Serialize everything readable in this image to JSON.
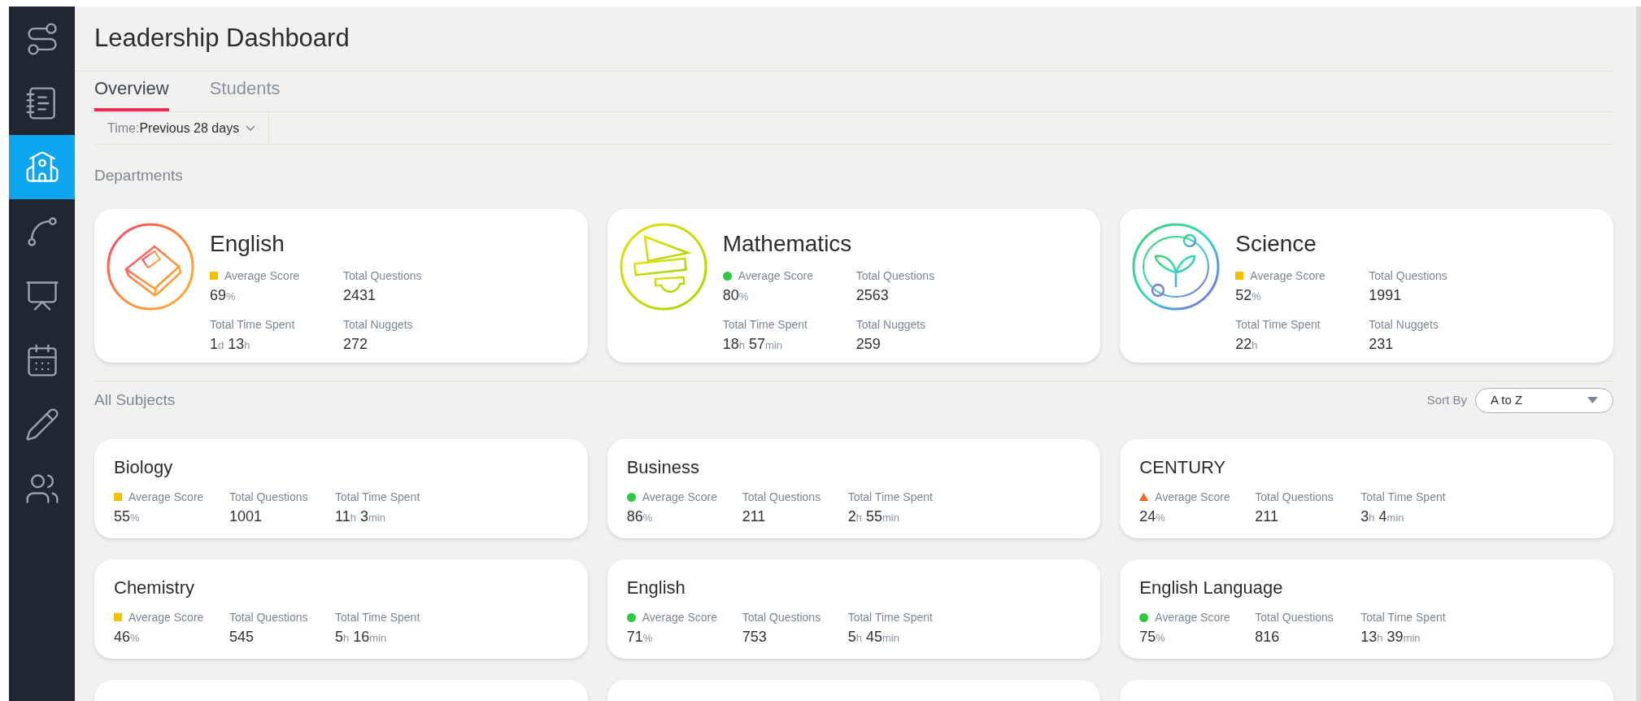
{
  "sidebar": {
    "items": [
      {
        "kind": "route",
        "selected": false
      },
      {
        "kind": "notebook",
        "selected": false
      },
      {
        "kind": "school",
        "selected": true
      },
      {
        "kind": "graph",
        "selected": false
      },
      {
        "kind": "teacher",
        "selected": false
      },
      {
        "kind": "calendar",
        "selected": false
      },
      {
        "kind": "pencil",
        "selected": false
      },
      {
        "kind": "people",
        "selected": false
      }
    ]
  },
  "title": "Leadership Dashboard",
  "tabs": [
    {
      "label": "Overview",
      "selected": true
    },
    {
      "label": "Students",
      "selected": false
    }
  ],
  "filter": {
    "label": "Time:",
    "value": "Previous 28 days"
  },
  "departments": {
    "heading": "Departments",
    "cards": [
      {
        "name": "English",
        "kind": "book",
        "indicator": {
          "kind": "square",
          "color": "#f5c000"
        },
        "score_label": "Average Score",
        "score": [
          {
            "value": "69",
            "unit": "%"
          }
        ],
        "questions_label": "Total Questions",
        "questions": "2431",
        "time_label": "Total Time Spent",
        "time": [
          {
            "value": "1",
            "unit": "d"
          },
          {
            "value": "13",
            "unit": "h"
          }
        ],
        "nuggets_label": "Total Nuggets",
        "nuggets": "272"
      },
      {
        "name": "Mathematics",
        "kind": "ruler",
        "indicator": {
          "kind": "dot",
          "color": "#2ec940"
        },
        "score_label": "Average Score",
        "score": [
          {
            "value": "80",
            "unit": "%"
          }
        ],
        "questions_label": "Total Questions",
        "questions": "2563",
        "time_label": "Total Time Spent",
        "time": [
          {
            "value": "18",
            "unit": "h"
          },
          {
            "value": "57",
            "unit": "min"
          }
        ],
        "nuggets_label": "Total Nuggets",
        "nuggets": "259"
      },
      {
        "name": "Science",
        "kind": "plant",
        "indicator": {
          "kind": "square",
          "color": "#f5c000"
        },
        "score_label": "Average Score",
        "score": [
          {
            "value": "52",
            "unit": "%"
          }
        ],
        "questions_label": "Total Questions",
        "questions": "1991",
        "time_label": "Total Time Spent",
        "time": [
          {
            "value": "22",
            "unit": "h"
          }
        ],
        "nuggets_label": "Total Nuggets",
        "nuggets": "231"
      }
    ]
  },
  "subjects": {
    "heading": "All Subjects",
    "sort_label": "Sort By",
    "sort_value": "A to Z",
    "cards": [
      {
        "name": "Biology",
        "indicator": {
          "kind": "square",
          "color": "#f5c000"
        },
        "score_label": "Average Score",
        "score": [
          {
            "value": "55",
            "unit": "%"
          }
        ],
        "questions_label": "Total Questions",
        "questions": "1001",
        "time_label": "Total Time Spent",
        "time": [
          {
            "value": "11",
            "unit": "h"
          },
          {
            "value": "3",
            "unit": "min"
          }
        ]
      },
      {
        "name": "Business",
        "indicator": {
          "kind": "dot",
          "color": "#2ec940"
        },
        "score_label": "Average Score",
        "score": [
          {
            "value": "86",
            "unit": "%"
          }
        ],
        "questions_label": "Total Questions",
        "questions": "211",
        "time_label": "Total Time Spent",
        "time": [
          {
            "value": "2",
            "unit": "h"
          },
          {
            "value": "55",
            "unit": "min"
          }
        ]
      },
      {
        "name": "CENTURY",
        "indicator": {
          "kind": "triangle",
          "color": "#f2641e"
        },
        "score_label": "Average Score",
        "score": [
          {
            "value": "24",
            "unit": "%"
          }
        ],
        "questions_label": "Total Questions",
        "questions": "211",
        "time_label": "Total Time Spent",
        "time": [
          {
            "value": "3",
            "unit": "h"
          },
          {
            "value": "4",
            "unit": "min"
          }
        ]
      },
      {
        "name": "Chemistry",
        "indicator": {
          "kind": "square",
          "color": "#f5c000"
        },
        "score_label": "Average Score",
        "score": [
          {
            "value": "46",
            "unit": "%"
          }
        ],
        "questions_label": "Total Questions",
        "questions": "545",
        "time_label": "Total Time Spent",
        "time": [
          {
            "value": "5",
            "unit": "h"
          },
          {
            "value": "16",
            "unit": "min"
          }
        ]
      },
      {
        "name": "English",
        "indicator": {
          "kind": "dot",
          "color": "#2ec940"
        },
        "score_label": "Average Score",
        "score": [
          {
            "value": "71",
            "unit": "%"
          }
        ],
        "questions_label": "Total Questions",
        "questions": "753",
        "time_label": "Total Time Spent",
        "time": [
          {
            "value": "5",
            "unit": "h"
          },
          {
            "value": "45",
            "unit": "min"
          }
        ]
      },
      {
        "name": "English Language",
        "indicator": {
          "kind": "dot",
          "color": "#2ec940"
        },
        "score_label": "Average Score",
        "score": [
          {
            "value": "75",
            "unit": "%"
          }
        ],
        "questions_label": "Total Questions",
        "questions": "816",
        "time_label": "Total Time Spent",
        "time": [
          {
            "value": "13",
            "unit": "h"
          },
          {
            "value": "39",
            "unit": "min"
          }
        ]
      }
    ],
    "cut_off_cards": [
      {
        "kind": "cut"
      },
      {
        "kind": "cut"
      },
      {
        "kind": "cut"
      }
    ]
  }
}
